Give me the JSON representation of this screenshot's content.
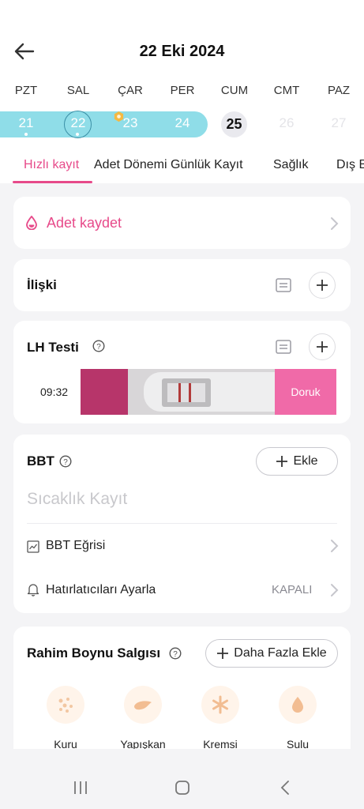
{
  "header": {
    "title": "22 Eki 2024",
    "weekdays": [
      "PZT",
      "SAL",
      "ÇAR",
      "PER",
      "CUM",
      "CMT",
      "PAZ"
    ],
    "dates": [
      "21",
      "22",
      "23",
      "24",
      "25",
      "26",
      "27"
    ],
    "colors": {
      "period_band": "#8fdde8",
      "accent": "#e74a8a",
      "selected_ring": "#3a8fa6"
    }
  },
  "tabs": [
    "Hızlı kayıt",
    "Adet Dönemi Günlük Kayıt",
    "Sağlık",
    "Dış B"
  ],
  "period_card": {
    "label": "Adet kaydet"
  },
  "relationship_card": {
    "title": "İlişki"
  },
  "lh_card": {
    "title": "LH Testi",
    "time": "09:32",
    "result": "Doruk"
  },
  "bbt_card": {
    "title": "BBT",
    "add_label": "Ekle",
    "placeholder": "Sıcaklık Kayıt",
    "chart_label": "BBT Eğrisi",
    "reminder_label": "Hatırlatıcıları Ayarla",
    "reminder_status": "KAPALI"
  },
  "cervical_card": {
    "title": "Rahim Boynu Salgısı",
    "add_more_label": "Daha Fazla Ekle",
    "options": [
      "Kuru",
      "Yapışkan",
      "Kremsi",
      "Sulu"
    ]
  }
}
